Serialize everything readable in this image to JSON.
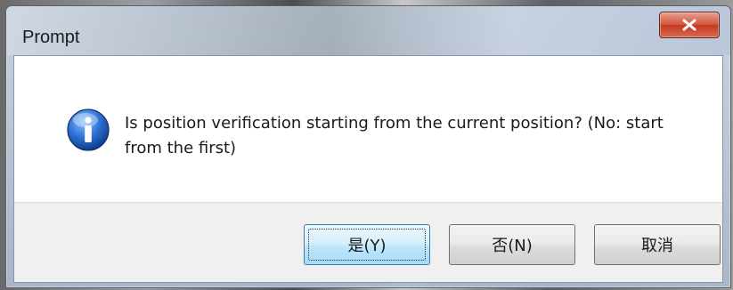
{
  "dialog": {
    "title": "Prompt",
    "message": "Is position verification starting from the current position? (No: start from the first)",
    "icon": "information-icon",
    "buttons": {
      "yes": "是(Y)",
      "no": "否(N)",
      "cancel": "取消"
    }
  },
  "colors": {
    "close_button": "#c53a22",
    "default_button_border": "#3c7fb1",
    "info_icon": "#1f5fc0",
    "button_bar": "#f0f0f0"
  }
}
